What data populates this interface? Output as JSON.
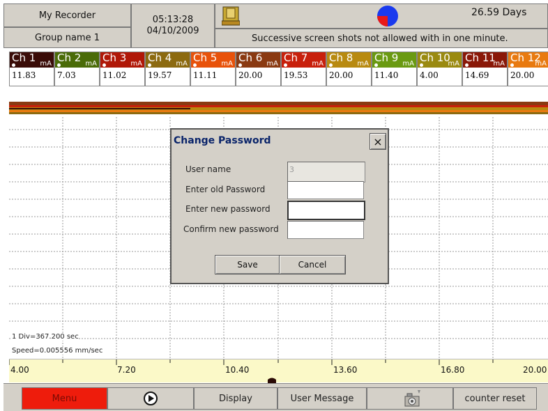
{
  "header": {
    "recorder_name": "My Recorder",
    "group_name": "Group name 1",
    "time": "05:13:28",
    "date": "04/10/2009",
    "days": "26.59 Days",
    "message": "Successive screen shots not allowed with in one minute."
  },
  "channels": [
    {
      "name": "Ch 1",
      "unit": "mA",
      "value": "11.83",
      "color": "#3a0c08"
    },
    {
      "name": "Ch 2",
      "unit": "mA",
      "value": "7.03",
      "color": "#4a6b08"
    },
    {
      "name": "Ch 3",
      "unit": "mA",
      "value": "11.02",
      "color": "#b01808"
    },
    {
      "name": "Ch 4",
      "unit": "mA",
      "value": "19.57",
      "color": "#8c6a10"
    },
    {
      "name": "Ch 5",
      "unit": "mA",
      "value": "11.11",
      "color": "#e8520a"
    },
    {
      "name": "Ch 6",
      "unit": "mA",
      "value": "20.00",
      "color": "#8a3a12"
    },
    {
      "name": "Ch 7",
      "unit": "mA",
      "value": "19.53",
      "color": "#c8200c"
    },
    {
      "name": "Ch 8",
      "unit": "mA",
      "value": "20.00",
      "color": "#b88a10"
    },
    {
      "name": "Ch 9",
      "unit": "mA",
      "value": "11.40",
      "color": "#6a9a12"
    },
    {
      "name": "Ch 10",
      "unit": "mA",
      "value": "4.00",
      "color": "#9a8a10"
    },
    {
      "name": "Ch 11",
      "unit": "mA",
      "value": "14.69",
      "color": "#8a1808"
    },
    {
      "name": "Ch 12",
      "unit": "mA",
      "value": "20.00",
      "color": "#e87a10"
    }
  ],
  "chart": {
    "div_label": "1 Div=367.200 sec",
    "speed_label": "Speed=0.005556 mm/sec"
  },
  "scale": {
    "ticks": [
      "4.00",
      "7.20",
      "10.40",
      "13.60",
      "16.80",
      "20.00"
    ]
  },
  "dialog": {
    "title": "Change Password",
    "close": "×",
    "user_name_label": "User name",
    "user_name_value": "3",
    "old_password_label": "Enter old Password",
    "new_password_label": "Enter new password",
    "confirm_password_label": "Confirm new password",
    "save_label": "Save",
    "cancel_label": "Cancel"
  },
  "bottom_bar": {
    "menu": "Menu",
    "display": "Display",
    "user_message": "User Message",
    "counter_reset": "counter reset"
  },
  "colors": {
    "menu_red": "#ee1c0c",
    "scale_yellow": "#fbf9c8",
    "dialog_title": "#0a246a"
  },
  "icons": {
    "header_icon": "disk-icon",
    "pie_icon": "pie-status-icon",
    "play_icon": "play-icon",
    "camera_icon": "camera-icon",
    "close_icon": "close-icon"
  }
}
